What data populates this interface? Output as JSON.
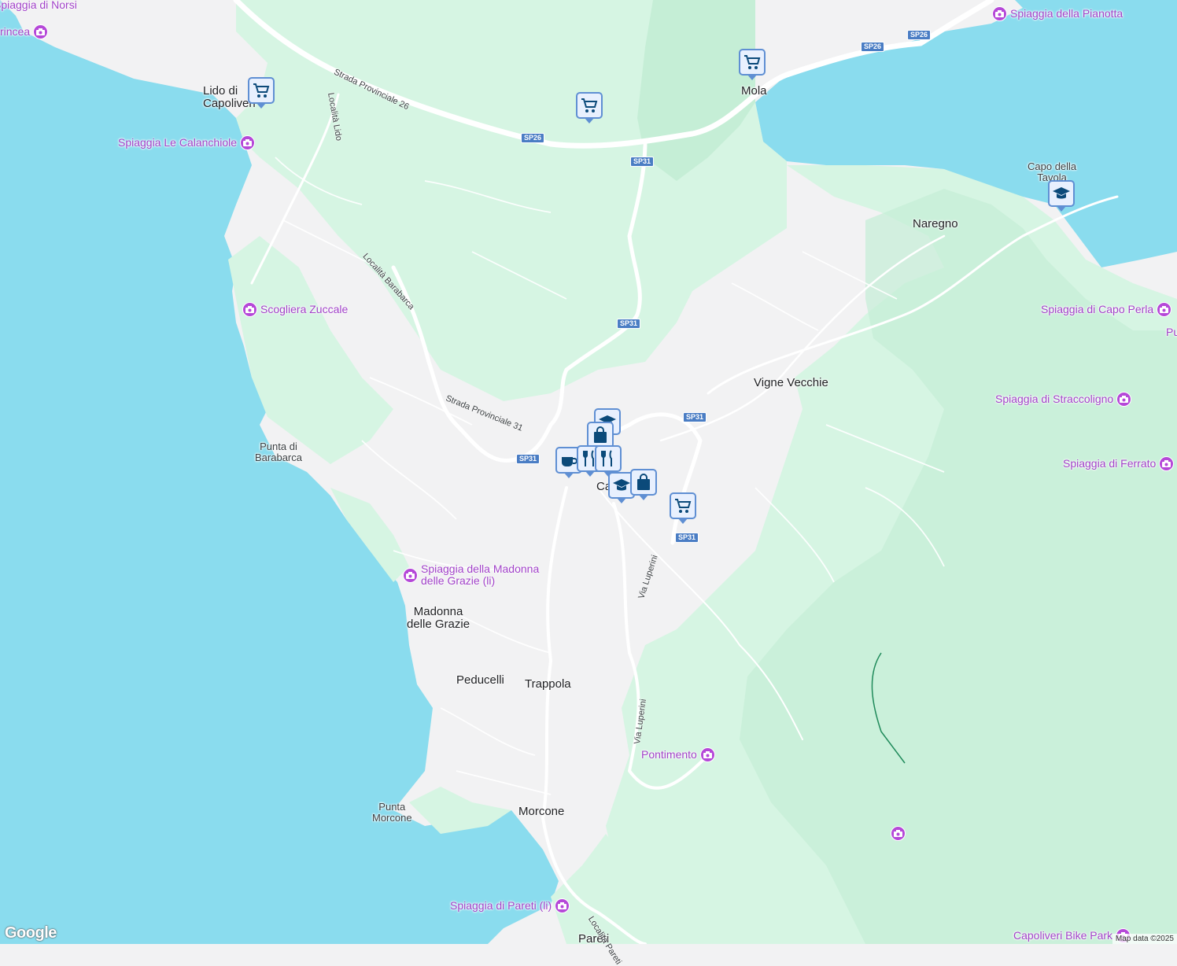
{
  "colors": {
    "sea": "#8adcee",
    "land": "#f2f2f3",
    "green": "#d0f5e0",
    "greenDark": "#c2eed2",
    "road": "#ffffff",
    "poi": "#a142c8",
    "pin": "#5f8fd3",
    "pinIcon": "#0b4a7a"
  },
  "places": [
    {
      "text": "Lido di\nCapoliveri"
    },
    {
      "text": "Mola"
    },
    {
      "text": "Naregno"
    },
    {
      "text": "Vigne Vecchie"
    },
    {
      "text": "Madonna\ndelle Grazie"
    },
    {
      "text": "Peducelli"
    },
    {
      "text": "Trappola"
    },
    {
      "text": "Morcone"
    },
    {
      "text": "Pareti"
    },
    {
      "text": "Ca"
    }
  ],
  "small_places": [
    {
      "text": "Capo della\nTavola"
    },
    {
      "text": "Punta di\nBarabarca"
    },
    {
      "text": "Punta\nMorcone"
    }
  ],
  "pois": [
    {
      "text": "Spiaggia di Norsi"
    },
    {
      "text": "rincea"
    },
    {
      "text": "Spiaggia della Pianotta"
    },
    {
      "text": "Spiaggia Le Calanchiole"
    },
    {
      "text": "Scogliera Zuccale"
    },
    {
      "text": "Spiaggia di Capo Perla"
    },
    {
      "text": "Pu"
    },
    {
      "text": "Spiaggia di Straccoligno"
    },
    {
      "text": "Spiaggia di Ferrato"
    },
    {
      "text": "Spiaggia della Madonna\ndelle Grazie (li)"
    },
    {
      "text": "Pontimento"
    },
    {
      "text": ""
    },
    {
      "text": "Spiaggia di Pareti (li)"
    },
    {
      "text": "Capoliveri Bike Park"
    }
  ],
  "road_labels": [
    {
      "text": "Strada Provinciale 26"
    },
    {
      "text": "Località Lido"
    },
    {
      "text": "Località Barabarca"
    },
    {
      "text": "Strada Provinciale 31"
    },
    {
      "text": "Via Luperini"
    },
    {
      "text": "Via Luperini"
    },
    {
      "text": "Località Pareti"
    }
  ],
  "shields": [
    {
      "text": "SP26"
    },
    {
      "text": "SP26"
    },
    {
      "text": "SP26"
    },
    {
      "text": "SP31"
    },
    {
      "text": "SP31"
    },
    {
      "text": "SP31"
    },
    {
      "text": "SP31"
    },
    {
      "text": "SP31"
    }
  ],
  "pins": [
    {
      "icon": "cart-icon"
    },
    {
      "icon": "cart-icon"
    },
    {
      "icon": "cart-icon"
    },
    {
      "icon": "school-icon"
    },
    {
      "icon": "cart-icon"
    },
    {
      "icon": "school-icon"
    },
    {
      "icon": "bag-icon"
    },
    {
      "icon": "coffee-icon"
    },
    {
      "icon": "restaurant-icon"
    },
    {
      "icon": "restaurant-icon"
    },
    {
      "icon": "school-icon"
    },
    {
      "icon": "bag-icon"
    }
  ],
  "attribution": "Map data ©2025",
  "logo": "Google"
}
